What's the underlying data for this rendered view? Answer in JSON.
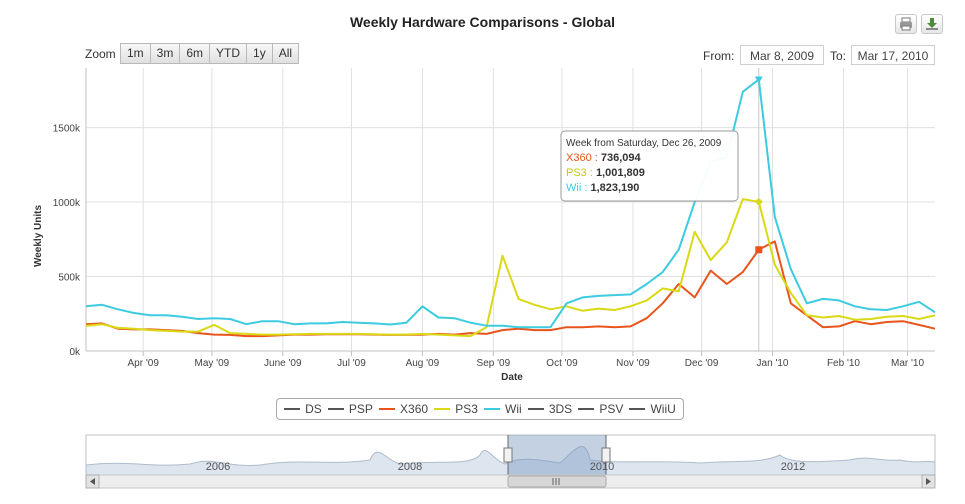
{
  "title": "Weekly Hardware Comparisons - Global",
  "toolbar": {
    "print_icon": "printer-icon",
    "export_icon": "download-icon"
  },
  "zoom": {
    "label": "Zoom",
    "buttons": [
      "1m",
      "3m",
      "6m",
      "YTD",
      "1y",
      "All"
    ]
  },
  "range": {
    "from_label": "From:",
    "from_value": "Mar 8, 2009",
    "to_label": "To:",
    "to_value": "Mar 17, 2010"
  },
  "legend": [
    {
      "name": "DS",
      "color": "#555555"
    },
    {
      "name": "PSP",
      "color": "#555555"
    },
    {
      "name": "X360",
      "color": "#e8541c"
    },
    {
      "name": "PS3",
      "color": "#d9d916"
    },
    {
      "name": "Wii",
      "color": "#3ccbe0"
    },
    {
      "name": "3DS",
      "color": "#555555"
    },
    {
      "name": "PSV",
      "color": "#555555"
    },
    {
      "name": "WiiU",
      "color": "#555555"
    }
  ],
  "tooltip": {
    "header": "Week from Saturday, Dec 26, 2009",
    "rows": [
      {
        "name": "X360",
        "value": "736,094",
        "color": "#e8541c"
      },
      {
        "name": "PS3",
        "value": "1,001,809",
        "color": "#d9d916"
      },
      {
        "name": "Wii",
        "value": "1,823,190",
        "color": "#3ccbe0"
      }
    ]
  },
  "navigator": {
    "year_labels": [
      "2006",
      "2008",
      "2010",
      "2012"
    ],
    "left_arrow": "left-arrow-icon",
    "right_arrow": "right-arrow-icon",
    "grip": "grip-icon"
  },
  "chart_data": {
    "type": "line",
    "title": "Weekly Hardware Comparisons - Global",
    "xlabel": "Date",
    "ylabel": "Weekly Units",
    "x_tick_labels": [
      "Apr '09",
      "May '09",
      "June '09",
      "Jul '09",
      "Aug '09",
      "Sep '09",
      "Oct '09",
      "Nov '09",
      "Dec '09",
      "Jan '10",
      "Feb '10",
      "Mar '10"
    ],
    "y_tick_labels": [
      "0k",
      "500k",
      "1000k",
      "1500k"
    ],
    "ylim": [
      0,
      1900000
    ],
    "grid": true,
    "legend_position": "bottom",
    "weeks": [
      "2009-03-07",
      "2009-03-14",
      "2009-03-21",
      "2009-03-28",
      "2009-04-04",
      "2009-04-11",
      "2009-04-18",
      "2009-04-25",
      "2009-05-02",
      "2009-05-09",
      "2009-05-16",
      "2009-05-23",
      "2009-05-30",
      "2009-06-06",
      "2009-06-13",
      "2009-06-20",
      "2009-06-27",
      "2009-07-04",
      "2009-07-11",
      "2009-07-18",
      "2009-07-25",
      "2009-08-01",
      "2009-08-08",
      "2009-08-15",
      "2009-08-22",
      "2009-08-29",
      "2009-09-05",
      "2009-09-12",
      "2009-09-19",
      "2009-09-26",
      "2009-10-03",
      "2009-10-10",
      "2009-10-17",
      "2009-10-24",
      "2009-10-31",
      "2009-11-07",
      "2009-11-14",
      "2009-11-21",
      "2009-11-28",
      "2009-12-05",
      "2009-12-12",
      "2009-12-19",
      "2009-12-26",
      "2010-01-02",
      "2010-01-09",
      "2010-01-16",
      "2010-01-23",
      "2010-01-30",
      "2010-02-06",
      "2010-02-13",
      "2010-02-20",
      "2010-02-27",
      "2010-03-06",
      "2010-03-13"
    ],
    "series": [
      {
        "name": "X360",
        "color": "#e8541c",
        "values": [
          180000,
          185000,
          150000,
          145000,
          145000,
          140000,
          135000,
          120000,
          110000,
          108000,
          100000,
          100000,
          105000,
          110000,
          110000,
          112000,
          112000,
          112000,
          110000,
          108000,
          108000,
          110000,
          115000,
          110000,
          120000,
          115000,
          140000,
          150000,
          140000,
          140000,
          160000,
          160000,
          165000,
          160000,
          165000,
          220000,
          320000,
          450000,
          360000,
          540000,
          450000,
          530000,
          680000,
          736094,
          320000,
          240000,
          160000,
          165000,
          200000,
          180000,
          195000,
          200000,
          175000,
          150000
        ]
      },
      {
        "name": "PS3",
        "color": "#d9d916",
        "values": [
          170000,
          180000,
          155000,
          150000,
          140000,
          135000,
          130000,
          130000,
          175000,
          120000,
          115000,
          110000,
          110000,
          112000,
          115000,
          115000,
          115000,
          115000,
          112000,
          110000,
          110000,
          115000,
          110000,
          105000,
          100000,
          160000,
          640000,
          350000,
          310000,
          280000,
          300000,
          270000,
          285000,
          275000,
          300000,
          340000,
          420000,
          400000,
          800000,
          610000,
          730000,
          1020000,
          1001809,
          580000,
          390000,
          240000,
          225000,
          235000,
          210000,
          215000,
          230000,
          235000,
          215000,
          240000
        ]
      },
      {
        "name": "Wii",
        "color": "#3ccbe0",
        "values": [
          300000,
          310000,
          280000,
          255000,
          240000,
          240000,
          230000,
          215000,
          220000,
          215000,
          180000,
          200000,
          200000,
          180000,
          185000,
          185000,
          195000,
          190000,
          185000,
          178000,
          190000,
          300000,
          225000,
          220000,
          190000,
          170000,
          170000,
          160000,
          160000,
          160000,
          320000,
          360000,
          370000,
          375000,
          380000,
          450000,
          530000,
          680000,
          1000000,
          1270000,
          1300000,
          1740000,
          1823190,
          900000,
          550000,
          320000,
          350000,
          340000,
          300000,
          280000,
          275000,
          300000,
          330000,
          260000
        ]
      }
    ]
  }
}
